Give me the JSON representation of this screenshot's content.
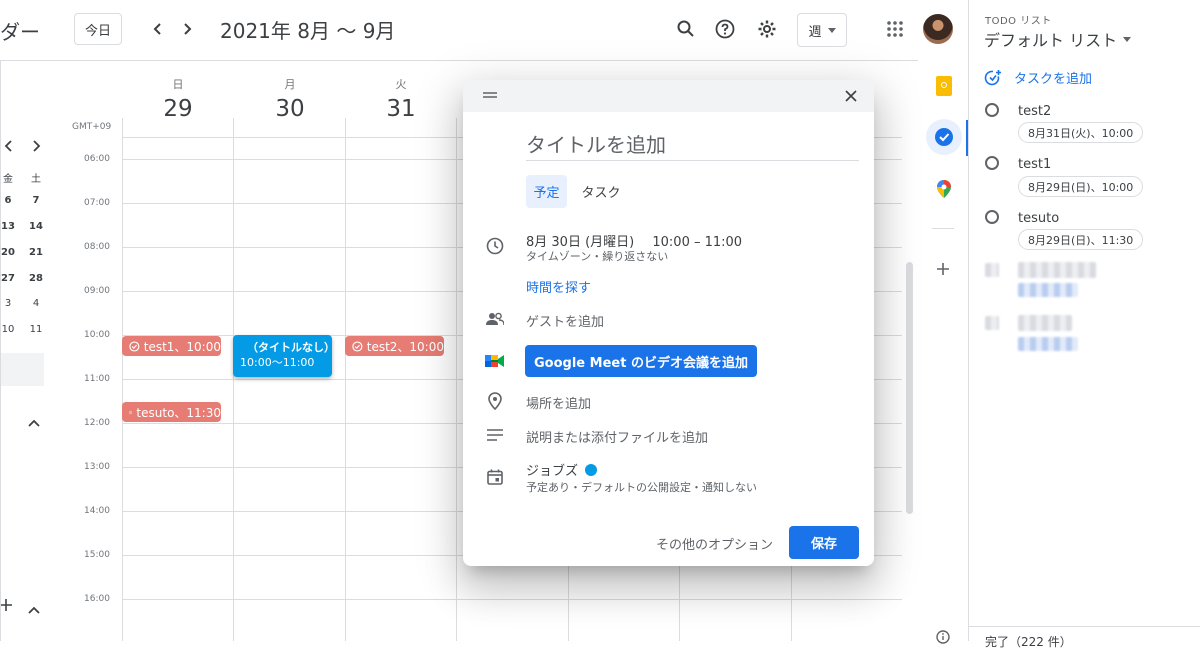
{
  "header": {
    "app_name_fragment": "ダー",
    "today_label": "今日",
    "date_range": "2021年 8月 ～ 9月",
    "view_label": "週"
  },
  "mini_calendar": {
    "weekdays": [
      "金",
      "土"
    ],
    "rows": [
      [
        "6",
        "7"
      ],
      [
        "13",
        "14"
      ],
      [
        "20",
        "21"
      ],
      [
        "27",
        "28"
      ],
      [
        "3",
        "4"
      ],
      [
        "10",
        "11"
      ]
    ]
  },
  "week": {
    "timezone": "GMT+09",
    "days": [
      {
        "name": "日",
        "num": "29"
      },
      {
        "name": "月",
        "num": "30"
      },
      {
        "name": "火",
        "num": "31"
      }
    ],
    "hours": [
      "06:00",
      "07:00",
      "08:00",
      "09:00",
      "10:00",
      "11:00",
      "12:00",
      "13:00",
      "14:00",
      "15:00",
      "16:00"
    ]
  },
  "events": {
    "test1": "test1、10:00",
    "test2": "test2、10:00",
    "tesuto": "tesuto、11:30",
    "new_title": "（タイトルなし）",
    "new_time": "10:00～11:00"
  },
  "dialog": {
    "title_placeholder": "タイトルを追加",
    "tab_event": "予定",
    "tab_task": "タスク",
    "date": "8月 30日 (月曜日)",
    "time_range": "10:00 – 11:00",
    "timezone_repeat": "タイムゾーン・繰り返さない",
    "find_time": "時間を探す",
    "add_guests": "ゲストを追加",
    "meet_button": "Google Meet のビデオ会議を追加",
    "add_location": "場所を追加",
    "add_description": "説明または添付ファイルを追加",
    "calendar_name": "ジョブズ",
    "calendar_color": "#039be5",
    "calendar_details": "予定あり・デフォルトの公開設定・通知しない",
    "more_options": "その他のオプション",
    "save": "保存"
  },
  "todo": {
    "header": "TODO リスト",
    "list_name": "デフォルト リスト",
    "add_task": "タスクを追加",
    "tasks": [
      {
        "title": "test2",
        "due": "8月31日(火)、10:00"
      },
      {
        "title": "test1",
        "due": "8月29日(日)、10:00"
      },
      {
        "title": "tesuto",
        "due": "8月29日(日)、11:30"
      }
    ],
    "footer": "完了（222 件）"
  },
  "colors": {
    "event_red": "#e67c73",
    "event_blue": "#039be5",
    "primary_blue": "#1a73e8"
  }
}
